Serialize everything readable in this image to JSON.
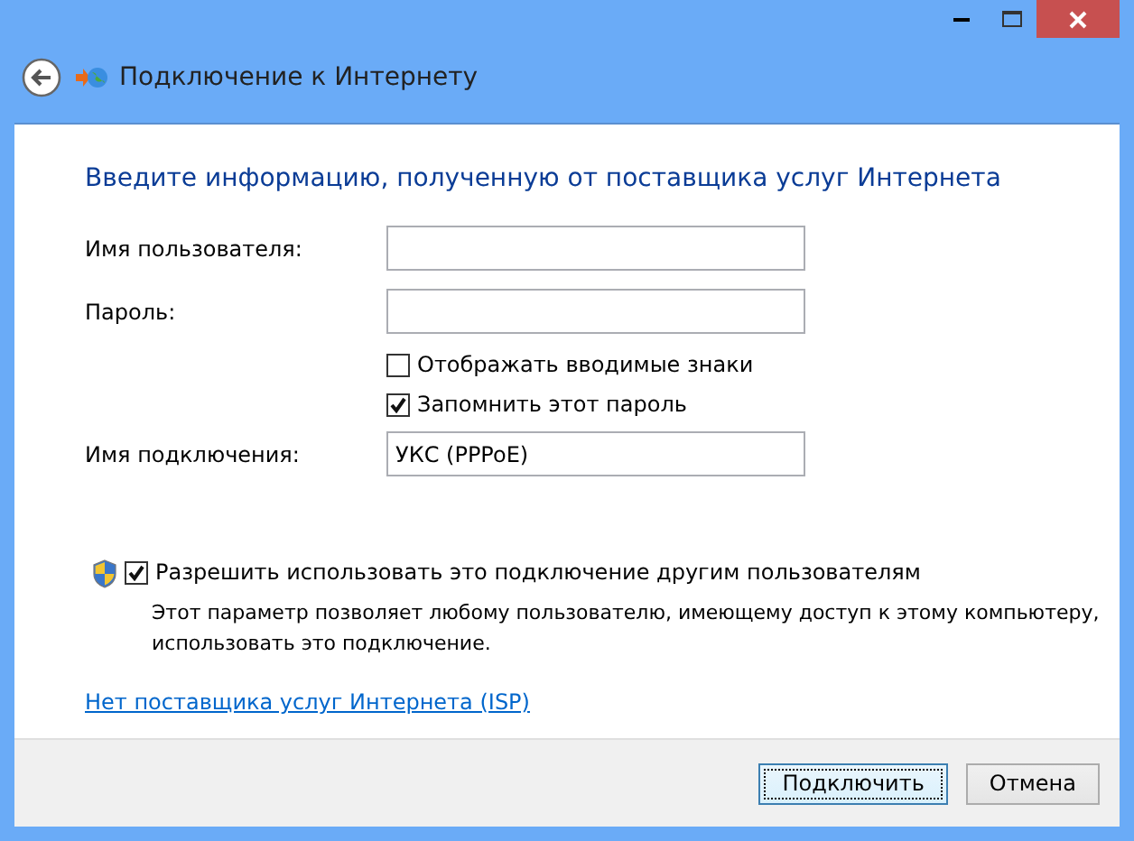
{
  "window": {
    "title": "Подключение к Интернету"
  },
  "heading": "Введите информацию, полученную от поставщика услуг Интернета",
  "fields": [
    {
      "kind": "field",
      "label": "Имя пользователя:"
    },
    {
      "kind": "field",
      "label": "Пароль:"
    },
    {
      "kind": "checkbox",
      "label": "Отображать вводимые знаки",
      "checked": false
    },
    {
      "kind": "checkbox",
      "label": "Запомнить этот пароль",
      "checked": true
    },
    {
      "kind": "field",
      "label": "Имя подключения:",
      "value": "УКС (PPPoE)"
    }
  ],
  "share": {
    "label": "Разрешить использовать это подключение другим пользователям",
    "checked": true,
    "description": "Этот параметр позволяет любому пользователю, имеющему доступ к этому компьютеру, использовать это подключение."
  },
  "link": "Нет поставщика услуг Интернета (ISP)",
  "buttons": [
    {
      "label": "Подключить",
      "default": true
    },
    {
      "label": "Отмена",
      "default": false
    }
  ]
}
